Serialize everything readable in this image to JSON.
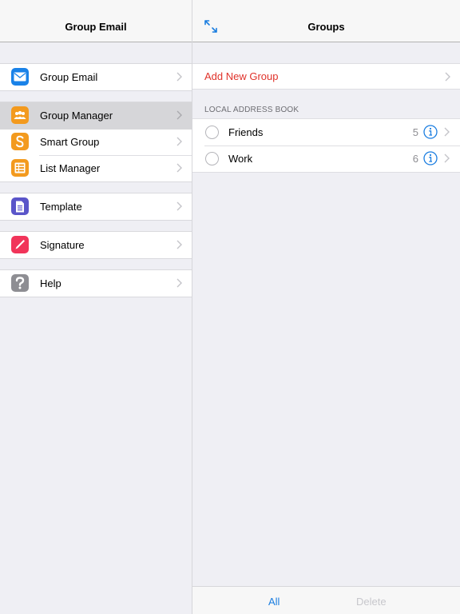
{
  "sidebar": {
    "title": "Group Email",
    "groups": [
      [
        {
          "label": "Group Email",
          "icon": "envelope-icon",
          "color": "#1a82e8"
        }
      ],
      [
        {
          "label": "Group Manager",
          "icon": "people-icon",
          "color": "#f39a1e",
          "selected": true
        },
        {
          "label": "Smart Group",
          "icon": "smart-s-icon",
          "color": "#f39a1e"
        },
        {
          "label": "List Manager",
          "icon": "list-icon",
          "color": "#f39a1e"
        }
      ],
      [
        {
          "label": "Template",
          "icon": "document-icon",
          "color": "#5a55c9"
        }
      ],
      [
        {
          "label": "Signature",
          "icon": "pen-icon",
          "color": "#f1345a"
        }
      ],
      [
        {
          "label": "Help",
          "icon": "question-icon",
          "color": "#8e8e93"
        }
      ]
    ]
  },
  "detail": {
    "title": "Groups",
    "add_label": "Add New Group",
    "section_header": "LOCAL ADDRESS BOOK",
    "groups": [
      {
        "name": "Friends",
        "count": "5"
      },
      {
        "name": "Work",
        "count": "6"
      }
    ],
    "toolbar": {
      "all_label": "All",
      "delete_label": "Delete"
    }
  },
  "colors": {
    "accent": "#1a7de0",
    "destructive": "#e0322a"
  }
}
